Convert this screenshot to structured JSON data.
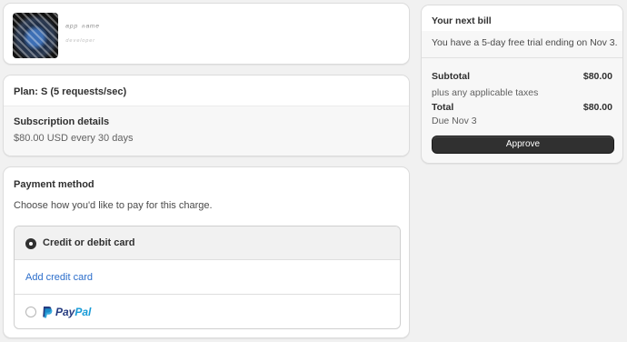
{
  "app": {
    "logo_icon": "app-logo-icon",
    "name": "ᵃᵖᵖ ⁿᵃᵐᵉ",
    "subtitle": "ᵈᵉᵛᵉˡᵒᵖᵉʳ"
  },
  "plan": {
    "title": "Plan: S (5 requests/sec)",
    "details_title": "Subscription details",
    "details_price": "$80.00 USD every 30 days"
  },
  "payment": {
    "title": "Payment method",
    "subtitle": "Choose how you'd like to pay for this charge.",
    "options": [
      {
        "label": "Credit or debit card",
        "selected": true
      },
      {
        "label": "PayPal",
        "selected": false,
        "icon": "paypal-icon"
      }
    ],
    "add_card_link": "Add credit card"
  },
  "bill": {
    "title": "Your next bill",
    "trial_text": "You have a 5-day free trial ending on Nov 3.",
    "subtotal_label": "Subtotal",
    "subtotal_value": "$80.00",
    "subtotal_note": "plus any applicable taxes",
    "total_label": "Total",
    "total_value": "$80.00",
    "total_note": "Due Nov 3",
    "approve_label": "Approve"
  },
  "colors": {
    "accent_link": "#2c6ecb",
    "button_bg": "#303030",
    "page_bg": "#f1f1f1",
    "paypal_dark": "#253b80",
    "paypal_light": "#179bd7"
  }
}
